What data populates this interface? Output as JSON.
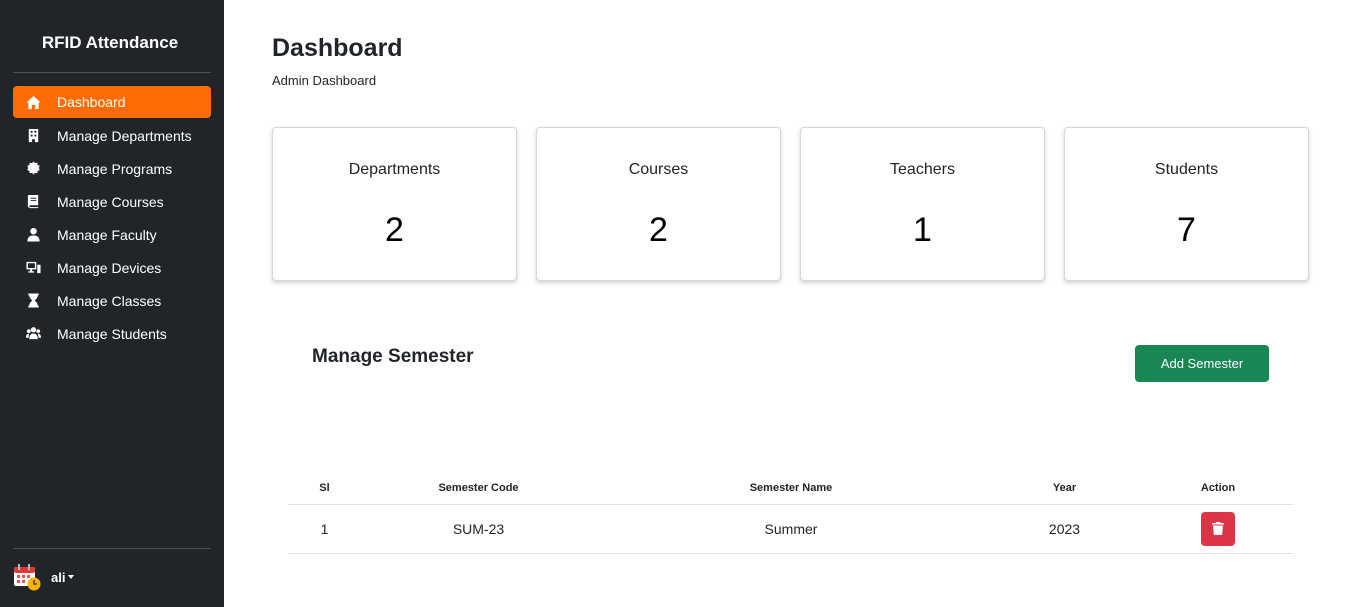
{
  "sidebar": {
    "brand": "RFID Attendance",
    "items": [
      {
        "label": "Dashboard",
        "icon": "home-icon",
        "active": true
      },
      {
        "label": "Manage Departments",
        "icon": "building-icon"
      },
      {
        "label": "Manage Programs",
        "icon": "certificate-icon"
      },
      {
        "label": "Manage Courses",
        "icon": "book-icon"
      },
      {
        "label": "Manage Faculty",
        "icon": "user-icon"
      },
      {
        "label": "Manage Devices",
        "icon": "devices-icon"
      },
      {
        "label": "Manage Classes",
        "icon": "hourglass-icon"
      },
      {
        "label": "Manage Students",
        "icon": "users-icon"
      }
    ],
    "user": {
      "name": "ali"
    }
  },
  "header": {
    "title": "Dashboard",
    "subtitle": "Admin Dashboard"
  },
  "stats": [
    {
      "label": "Departments",
      "value": "2"
    },
    {
      "label": "Courses",
      "value": "2"
    },
    {
      "label": "Teachers",
      "value": "1"
    },
    {
      "label": "Students",
      "value": "7"
    }
  ],
  "semester": {
    "title": "Manage Semester",
    "add_label": "Add Semester",
    "columns": [
      "Sl",
      "Semester Code",
      "Semester Name",
      "Year",
      "Action"
    ],
    "rows": [
      {
        "sl": "1",
        "code": "SUM-23",
        "name": "Summer",
        "year": "2023"
      }
    ]
  },
  "colors": {
    "sidebar": "#212529",
    "active": "#fd6c04",
    "add": "#198754",
    "delete": "#dc3545"
  }
}
